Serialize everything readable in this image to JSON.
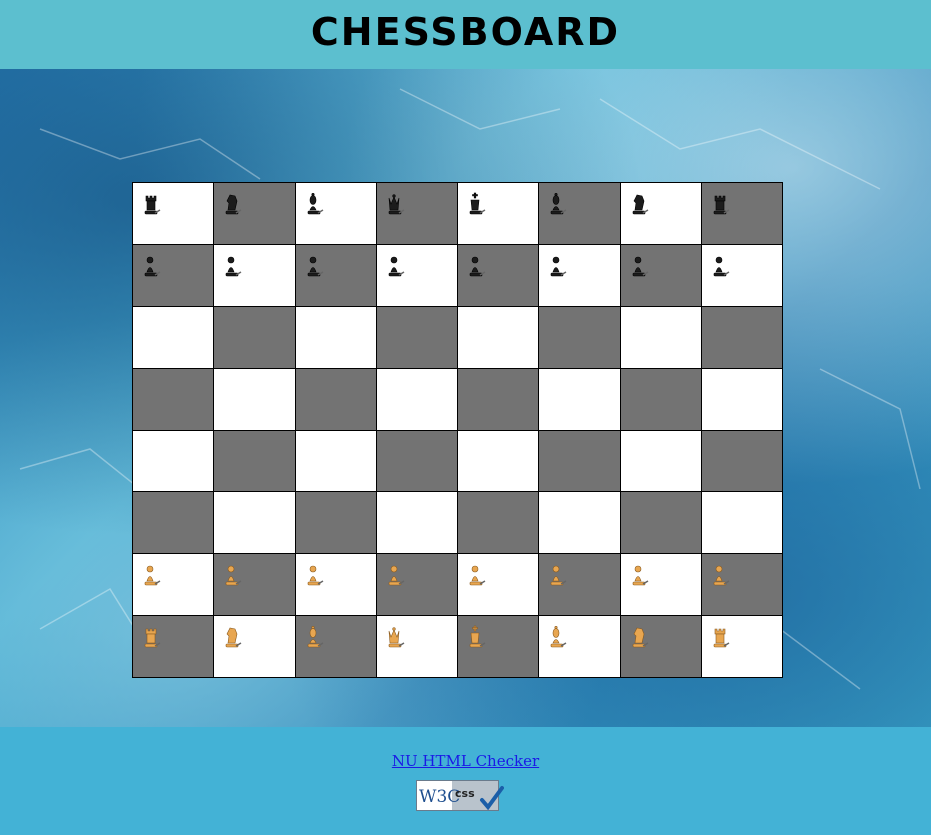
{
  "header": {
    "title": "Chessboard"
  },
  "board": {
    "rows": [
      [
        "black-rook",
        "black-knight",
        "black-bishop",
        "black-queen",
        "black-king",
        "black-bishop",
        "black-knight",
        "black-rook"
      ],
      [
        "black-pawn",
        "black-pawn",
        "black-pawn",
        "black-pawn",
        "black-pawn",
        "black-pawn",
        "black-pawn",
        "black-pawn"
      ],
      [
        "",
        "",
        "",
        "",
        "",
        "",
        "",
        ""
      ],
      [
        "",
        "",
        "",
        "",
        "",
        "",
        "",
        ""
      ],
      [
        "",
        "",
        "",
        "",
        "",
        "",
        "",
        ""
      ],
      [
        "",
        "",
        "",
        "",
        "",
        "",
        "",
        ""
      ],
      [
        "white-pawn",
        "white-pawn",
        "white-pawn",
        "white-pawn",
        "white-pawn",
        "white-pawn",
        "white-pawn",
        "white-pawn"
      ],
      [
        "white-rook",
        "white-knight",
        "white-bishop",
        "white-queen",
        "white-king",
        "white-bishop",
        "white-knight",
        "white-rook"
      ]
    ],
    "colors": {
      "light": "#ffffff",
      "dark": "#737373",
      "white_piece": "#e8a650",
      "black_piece": "#1c1c1c"
    }
  },
  "footer": {
    "checker_link": "NU HTML Checker",
    "css_badge": {
      "w3c": "W3C",
      "css": "css"
    }
  }
}
